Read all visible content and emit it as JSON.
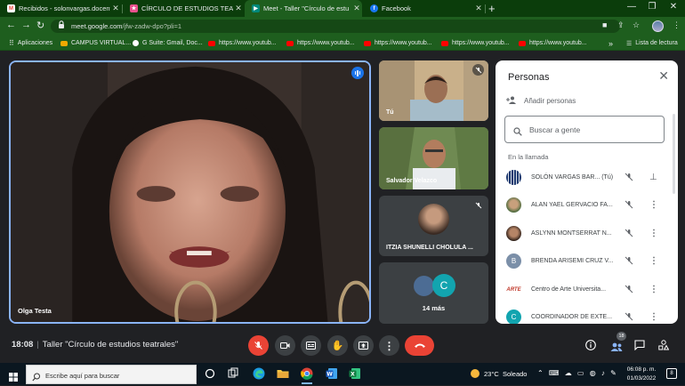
{
  "browser": {
    "tabs": [
      {
        "title": "Recibidos - solonvargas.docente",
        "favicon": "gmail-icon",
        "active": false
      },
      {
        "title": "CÍRCULO DE ESTUDIOS TEATRAL",
        "favicon": "classroom-icon",
        "active": false
      },
      {
        "title": "Meet - Taller \"Círculo de estu",
        "favicon": "meet-icon",
        "active": true
      },
      {
        "title": "Facebook",
        "favicon": "facebook-icon",
        "active": false
      }
    ],
    "new_tab": "+",
    "url_host": "meet.google.com",
    "url_path": "/jfw-zadw-dpo?pli=1",
    "bookmarks": [
      {
        "label": "Aplicaciones",
        "icon": "apps-grid-icon"
      },
      {
        "label": "CAMPUS VIRTUAL...",
        "icon": "campus-icon"
      },
      {
        "label": "G Suite: Gmail, Doc...",
        "icon": "google-icon"
      },
      {
        "label": "https://www.youtub...",
        "icon": "youtube-icon"
      },
      {
        "label": "https://www.youtub...",
        "icon": "youtube-icon"
      },
      {
        "label": "https://www.youtub...",
        "icon": "youtube-icon"
      },
      {
        "label": "https://www.youtub...",
        "icon": "youtube-icon"
      },
      {
        "label": "https://www.youtub...",
        "icon": "youtube-icon"
      }
    ],
    "more_bookmarks": "»",
    "reading_list": "Lista de lectura"
  },
  "meet": {
    "main_speaker": "Olga Testa",
    "tiles": [
      {
        "name": "Tú",
        "muted": true
      },
      {
        "name": "Salvador Velazco",
        "muted": false
      },
      {
        "name": "ITZIA SHUNELLI CHOLULA ...",
        "muted": true
      },
      {
        "name": "14 más",
        "avatar_letter": "C"
      }
    ],
    "clock": "18:08",
    "meeting_title": "Taller \"Círculo de estudios teatrales\"",
    "participant_count": "18"
  },
  "people_panel": {
    "title": "Personas",
    "add_people": "Añadir personas",
    "search_placeholder": "Buscar a gente",
    "section": "En la llamada",
    "participants": [
      {
        "name": "SOLÓN VARGAS BAR...  (Tú)",
        "avatar": "photo",
        "action": "pin"
      },
      {
        "name": "ALAN YAEL GERVACIO FA...",
        "avatar": "photo",
        "action": "more"
      },
      {
        "name": "ASLYNN MONTSERRAT N...",
        "avatar": "photo",
        "action": "more"
      },
      {
        "name": "BRENDA ARISEMI CRUZ V...",
        "avatar": "letter",
        "letter": "B",
        "color": "#7b8fa8",
        "action": "more"
      },
      {
        "name": "Centro de Arte Universita...",
        "avatar": "logo",
        "action": "more"
      },
      {
        "name": "COORDINADOR DE EXTE...",
        "avatar": "letter",
        "letter": "C",
        "color": "#12a4af",
        "action": "more"
      }
    ]
  },
  "taskbar": {
    "search_placeholder": "Escribe aquí para buscar",
    "weather_temp": "23°C",
    "weather_desc": "Soleado",
    "time": "06:08 p. m.",
    "date": "01/03/2022",
    "notifications": "8"
  },
  "colors": {
    "chrome_frame": "#0b3d0b",
    "chrome_toolbar": "#1e5e1e",
    "meet_bg": "#202124",
    "active_border": "#8ab4f8",
    "hangup_red": "#ea4335"
  }
}
